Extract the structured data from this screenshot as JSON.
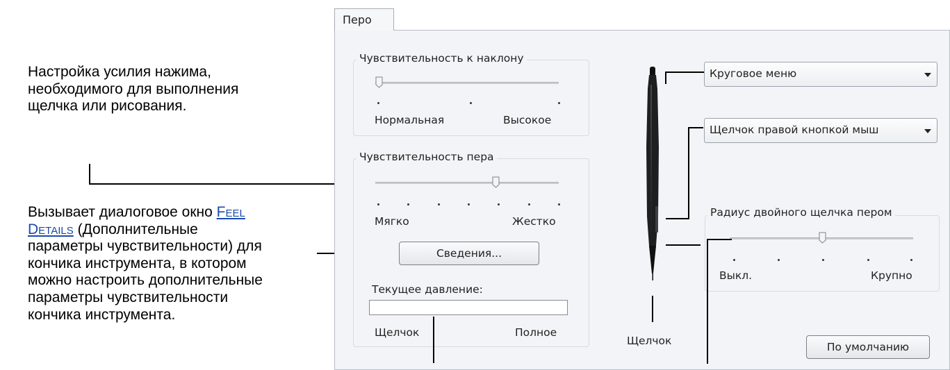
{
  "annotations": {
    "pressure_note": [
      "Настройка усилия нажима,",
      "необходимого для выполнения",
      "щелчка или рисования."
    ],
    "details_line1_link": "Feel ",
    "details_line2_link": "Details",
    "details_line2_rest": " (Дополнительные",
    "details_lines": [
      "параметры чувствительности) для",
      "кончика инструмента, в котором",
      "можно настроить дополнительные",
      "параметры чувствительности",
      "кончика инструмента."
    ],
    "details_line1_prefix": "Вызывает диалоговое окно "
  },
  "tab": {
    "label": "Перо"
  },
  "tilt": {
    "title": "Чувствительность к наклону",
    "min_label": "Нормальная",
    "max_label": "Высокое",
    "value": 0.0
  },
  "tip_feel": {
    "title": "Чувствительность пера",
    "min_label": "Мягко",
    "max_label": "Жестко",
    "value": 0.67
  },
  "details_button": "Сведения...",
  "current_pressure": {
    "label": "Текущее давление:",
    "min_label": "Щелчок",
    "max_label": "Полное"
  },
  "pen": {
    "tip_label": "Щелчок"
  },
  "upper_button": {
    "value": "Круговое меню"
  },
  "lower_button": {
    "value": "Щелчок правой кнопкой мыш"
  },
  "double_click": {
    "title": "Радиус двойного щелчка пером",
    "min_label": "Выкл.",
    "max_label": "Крупно",
    "value": 0.5
  },
  "default_button": "По умолчанию"
}
